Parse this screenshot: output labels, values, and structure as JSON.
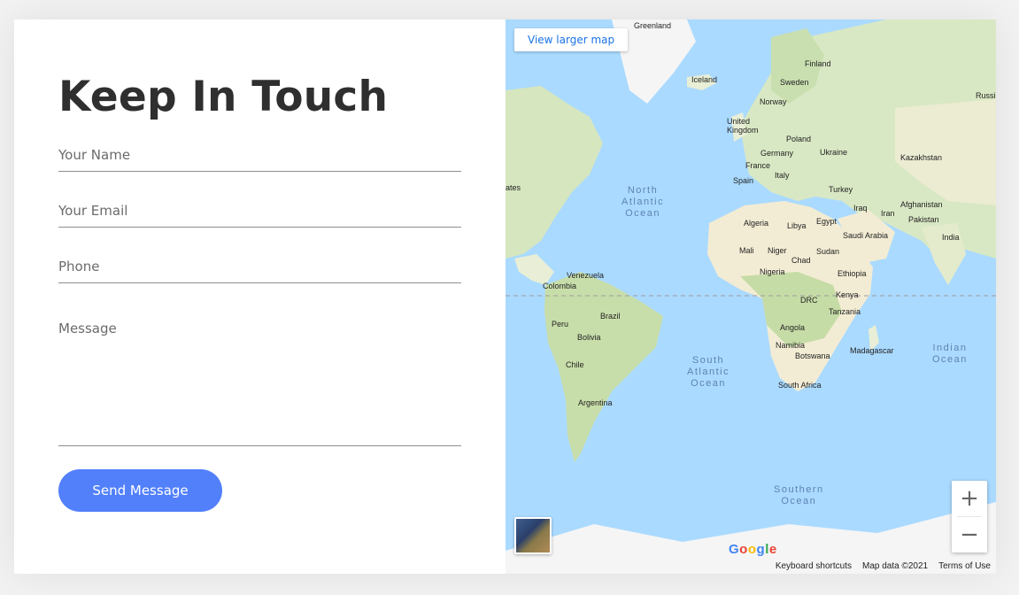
{
  "form": {
    "title": "Keep In Touch",
    "name_placeholder": "Your Name",
    "email_placeholder": "Your Email",
    "phone_placeholder": "Phone",
    "message_placeholder": "Message",
    "name_value": "",
    "email_value": "",
    "phone_value": "",
    "message_value": "",
    "submit_label": "Send Message"
  },
  "map": {
    "larger_map_link": "View larger map",
    "zoom_in": "+",
    "zoom_out": "−",
    "footer": {
      "shortcuts": "Keyboard shortcuts",
      "map_data": "Map data ©2021",
      "terms": "Terms of Use"
    },
    "logo": [
      "G",
      "o",
      "o",
      "g",
      "l",
      "e"
    ],
    "labels": {
      "greenland": "Greenland",
      "iceland": "Iceland",
      "finland": "Finland",
      "sweden": "Sweden",
      "norway": "Norway",
      "russia": "Russi",
      "uk": "United Kingdom",
      "poland": "Poland",
      "germany": "Germany",
      "ukraine": "Ukraine",
      "kazakhstan": "Kazakhstan",
      "france": "France",
      "spain": "Spain",
      "italy": "Italy",
      "turkey": "Turkey",
      "states": "ates",
      "iraq": "Iraq",
      "afghanistan": "Afghanistan",
      "iran": "Iran",
      "pakistan": "Pakistan",
      "algeria": "Algeria",
      "libya": "Libya",
      "egypt": "Egypt",
      "saudi": "Saudi Arabia",
      "india": "India",
      "mali": "Mali",
      "niger": "Niger",
      "chad": "Chad",
      "sudan": "Sudan",
      "nigeria": "Nigeria",
      "ethiopia": "Ethiopia",
      "venezuela": "Venezuela",
      "colombia": "Colombia",
      "kenya": "Kenya",
      "drc": "DRC",
      "tanzania": "Tanzania",
      "brazil": "Brazil",
      "peru": "Peru",
      "bolivia": "Bolivia",
      "angola": "Angola",
      "namibia": "Namibia",
      "botswana": "Botswana",
      "madagascar": "Madagascar",
      "chile": "Chile",
      "southafrica": "South Africa",
      "argentina": "Argentina"
    },
    "oceans": {
      "north_atlantic": "North\nAtlantic\nOcean",
      "south_atlantic": "South\nAtlantic\nOcean",
      "indian": "Indian\nOcean",
      "southern": "Southern\nOcean"
    },
    "colors": {
      "water": "#aadaff",
      "land": "#e8efd6",
      "forest": "#b9d7a2",
      "ice": "#f5f5f5",
      "desert": "#f3ecd4"
    }
  },
  "theme": {
    "accent": "#5280fb",
    "title_color": "#2f2f2f"
  }
}
